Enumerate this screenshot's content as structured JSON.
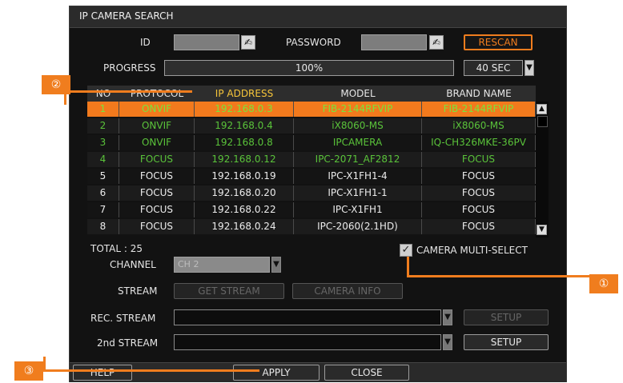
{
  "dialog": {
    "title": "IP CAMERA SEARCH"
  },
  "auth": {
    "id_label": "ID",
    "password_label": "PASSWORD",
    "rescan_label": "RESCAN"
  },
  "progress": {
    "label": "PROGRESS",
    "value_text": "100%",
    "timer_text": "40 SEC"
  },
  "table": {
    "headers": [
      "NO",
      "PROTOCOL",
      "IP ADDRESS",
      "MODEL",
      "BRAND NAME"
    ],
    "rows": [
      {
        "no": "1",
        "protocol": "ONVIF",
        "ip": "192.168.0.3",
        "model": "FIB-2144RFVIP",
        "brand": "FIB-2144RFVIP",
        "state": "selected"
      },
      {
        "no": "2",
        "protocol": "ONVIF",
        "ip": "192.168.0.4",
        "model": "iX8060-MS",
        "brand": "iX8060-MS",
        "state": "registered"
      },
      {
        "no": "3",
        "protocol": "ONVIF",
        "ip": "192.168.0.8",
        "model": "IPCAMERA",
        "brand": "IQ-CH326MKE-36PV",
        "state": "registered"
      },
      {
        "no": "4",
        "protocol": "FOCUS",
        "ip": "192.168.0.12",
        "model": "IPC-2071_AF2812",
        "brand": "FOCUS",
        "state": "registered"
      },
      {
        "no": "5",
        "protocol": "FOCUS",
        "ip": "192.168.0.19",
        "model": "IPC-X1FH1-4",
        "brand": "FOCUS",
        "state": "normal"
      },
      {
        "no": "6",
        "protocol": "FOCUS",
        "ip": "192.168.0.20",
        "model": "IPC-X1FH1-1",
        "brand": "FOCUS",
        "state": "normal"
      },
      {
        "no": "7",
        "protocol": "FOCUS",
        "ip": "192.168.0.22",
        "model": "IPC-X1FH1",
        "brand": "FOCUS",
        "state": "normal"
      },
      {
        "no": "8",
        "protocol": "FOCUS",
        "ip": "192.168.0.24",
        "model": "IPC-2060(2.1HD)",
        "brand": "FOCUS",
        "state": "normal"
      }
    ]
  },
  "total_text": "TOTAL : 25",
  "channel": {
    "label": "CHANNEL",
    "value": "CH 2"
  },
  "multi_select": {
    "label": "CAMERA MULTI-SELECT",
    "checked": true
  },
  "stream": {
    "label": "STREAM",
    "get_stream_label": "GET STREAM",
    "camera_info_label": "CAMERA INFO"
  },
  "rec_stream": {
    "label": "REC. STREAM",
    "value": "",
    "setup_label": "SETUP"
  },
  "second_stream": {
    "label": "2nd STREAM",
    "value": "",
    "setup_label": "SETUP"
  },
  "footer": {
    "help_label": "HELP",
    "apply_label": "APPLY",
    "close_label": "CLOSE"
  },
  "annotations": {
    "one": "①",
    "two": "②",
    "three": "③"
  },
  "colors": {
    "accent": "#f07d1e",
    "registered_green": "#5ac33a",
    "header_highlight": "#f6c53a"
  },
  "icons": {
    "keyboard": "keyboard-icon",
    "dropdown": "dropdown-arrow-icon",
    "scroll_up": "scroll-up-icon",
    "scroll_down": "scroll-down-icon",
    "check": "check-icon"
  }
}
